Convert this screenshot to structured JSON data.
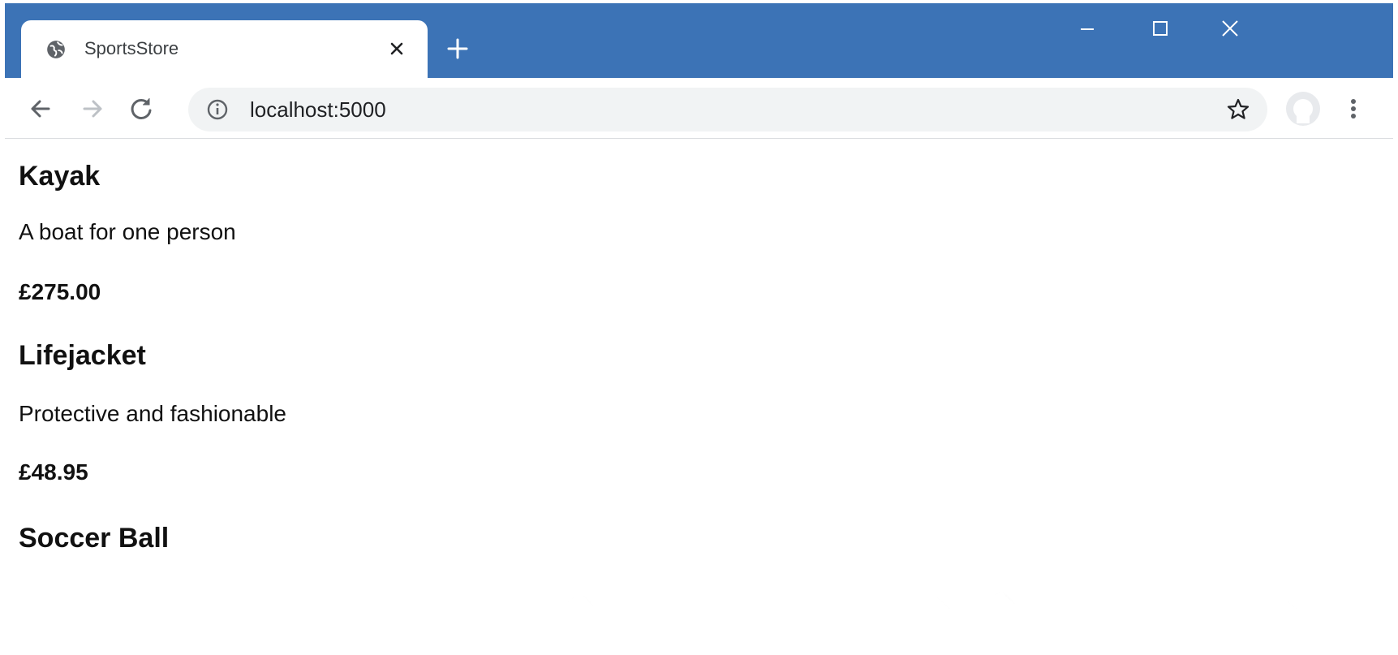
{
  "browser": {
    "tab": {
      "title": "SportsStore",
      "favicon": "globe-icon"
    },
    "address_bar": {
      "url": "localhost:5000"
    },
    "colors": {
      "titlebar": "#3c73b6",
      "omnibox": "#f1f3f4"
    }
  },
  "products": [
    {
      "name": "Kayak",
      "description": "A boat for one person",
      "price": "£275.00"
    },
    {
      "name": "Lifejacket",
      "description": "Protective and fashionable",
      "price": "£48.95"
    },
    {
      "name": "Soccer Ball"
    }
  ]
}
